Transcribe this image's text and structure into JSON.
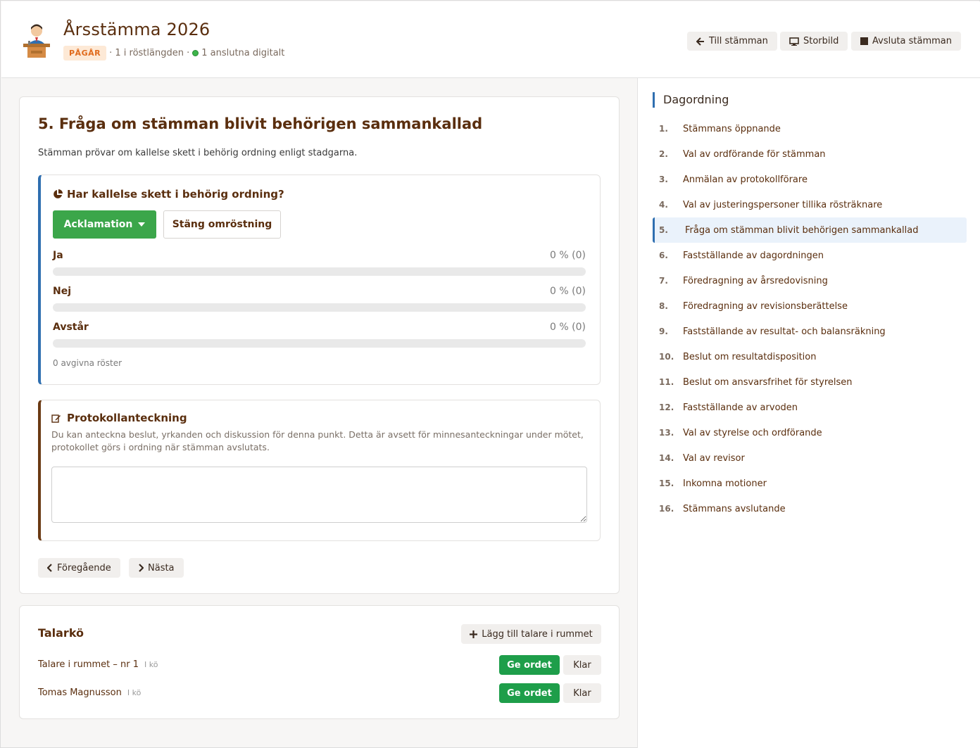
{
  "header": {
    "title": "Årsstämma 2026",
    "status_badge": "PÅGÅR",
    "meta_voters": "· 1 i röstlängden ·",
    "meta_connected": "1 anslutna digitalt",
    "buttons": {
      "to_meeting": "Till stämman",
      "big_screen": "Storbild",
      "end_meeting": "Avsluta stämman"
    }
  },
  "item": {
    "title": "5.  Fråga om stämman blivit behörigen sammankallad",
    "description": "Stämman prövar om kallelse skett i behörig ordning enligt stadgarna."
  },
  "vote": {
    "question": "Har kallelse skett i behörig ordning?",
    "mode_button": "Acklamation",
    "close_button": "Stäng omröstning",
    "options": [
      {
        "label": "Ja",
        "value_text": "0 % (0)",
        "percent": 0
      },
      {
        "label": "Nej",
        "value_text": "0 % (0)",
        "percent": 0
      },
      {
        "label": "Avstår",
        "value_text": "0 % (0)",
        "percent": 0
      }
    ],
    "count_text": "0 avgivna röster",
    "colors": {
      "accent": "#2f6fb0",
      "bar_fill": "#3ba64a"
    }
  },
  "notes": {
    "title": "Protokollanteckning",
    "description": "Du kan anteckna beslut, yrkanden och diskussion för denna punkt. Detta är avsett för minnesanteckningar under mötet, protokollet görs i ordning när stämman avslutats.",
    "value": ""
  },
  "nav": {
    "previous": "Föregående",
    "next": "Nästa"
  },
  "speakers": {
    "title": "Talarkö",
    "add_button": "Lägg till talare i rummet",
    "give_label": "Ge ordet",
    "done_label": "Klar",
    "list": [
      {
        "name": "Talare i rummet – nr 1",
        "status": "I kö"
      },
      {
        "name": "Tomas Magnusson",
        "status": "I kö"
      }
    ]
  },
  "agenda": {
    "title": "Dagordning",
    "active_index": 4,
    "items": [
      {
        "num": "1.",
        "label": "Stämmans öppnande"
      },
      {
        "num": "2.",
        "label": "Val av ordförande för stämman"
      },
      {
        "num": "3.",
        "label": "Anmälan av protokollförare"
      },
      {
        "num": "4.",
        "label": "Val av justeringspersoner tillika rösträknare"
      },
      {
        "num": "5.",
        "label": "Fråga om stämman blivit behörigen sammankallad"
      },
      {
        "num": "6.",
        "label": "Fastställande av dagordningen"
      },
      {
        "num": "7.",
        "label": "Föredragning av årsredovisning"
      },
      {
        "num": "8.",
        "label": "Föredragning av revisionsberättelse"
      },
      {
        "num": "9.",
        "label": "Fastställande av resultat- och balansräkning"
      },
      {
        "num": "10.",
        "label": "Beslut om resultatdisposition"
      },
      {
        "num": "11.",
        "label": "Beslut om ansvarsfrihet för styrelsen"
      },
      {
        "num": "12.",
        "label": "Fastställande av arvoden"
      },
      {
        "num": "13.",
        "label": "Val av styrelse och ordförande"
      },
      {
        "num": "14.",
        "label": "Val av revisor"
      },
      {
        "num": "15.",
        "label": "Inkomna motioner"
      },
      {
        "num": "16.",
        "label": "Stämmans avslutande"
      }
    ]
  },
  "icons": {
    "logo": "speaker-podium-icon",
    "back": "arrow-left-icon",
    "screen": "monitor-icon",
    "stop": "stop-square-icon",
    "chart": "pie-chart-icon",
    "caret": "caret-down-icon",
    "edit": "edit-note-icon",
    "prev": "chevron-left-icon",
    "next": "chevron-right-icon",
    "plus": "plus-icon"
  }
}
